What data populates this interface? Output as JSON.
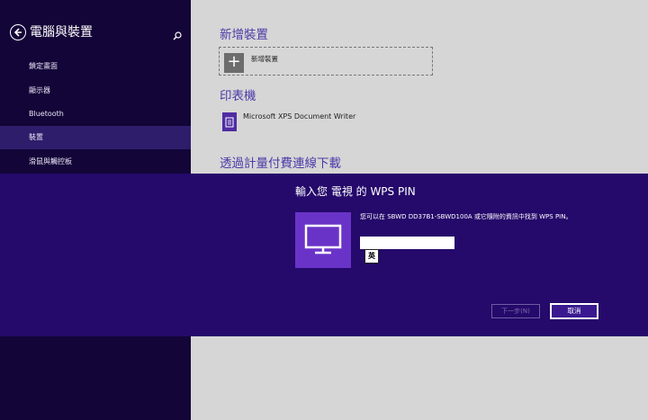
{
  "sidebar": {
    "title": "電腦與裝置",
    "icons": {
      "back": "back-arrow-icon",
      "search": "search-icon"
    },
    "items": [
      {
        "label": "鎖定畫面"
      },
      {
        "label": "顯示器"
      },
      {
        "label": "Bluetooth"
      },
      {
        "label": "裝置",
        "selected": true
      },
      {
        "label": "滑鼠與觸控板"
      }
    ]
  },
  "main": {
    "add_device": {
      "heading": "新增裝置",
      "button_label": "新增裝置",
      "icon": "plus-icon"
    },
    "printers": {
      "heading": "印表機",
      "items": [
        {
          "label": "Microsoft XPS Document Writer",
          "icon": "printer-icon"
        }
      ]
    },
    "metered": {
      "heading": "透過計量付費連線下載"
    }
  },
  "dialog": {
    "title": "輸入您 電視 的 WPS PIN",
    "description": "您可以在 SBWD DD37B1-SBWD100A 或它隨附的資訊中找到 WPS PIN。",
    "tile_icon": "tv-monitor-icon",
    "pin_value": "",
    "ime_indicator": "英",
    "next_label": "下一步(N)",
    "cancel_label": "取消"
  },
  "colors": {
    "sidebar_bg": "#130538",
    "sidebar_selected": "#2e1d6b",
    "main_bg": "#d6d6d6",
    "accent_text": "#4b3ba8",
    "dialog_bg": "#25096b",
    "tile_bg": "#6a33c8"
  }
}
